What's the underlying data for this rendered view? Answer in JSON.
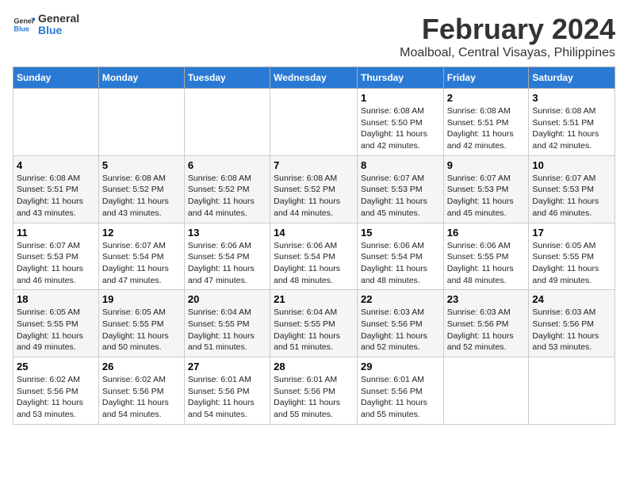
{
  "logo": {
    "line1": "General",
    "line2": "Blue"
  },
  "title": "February 2024",
  "subtitle": "Moalboal, Central Visayas, Philippines",
  "days_header": [
    "Sunday",
    "Monday",
    "Tuesday",
    "Wednesday",
    "Thursday",
    "Friday",
    "Saturday"
  ],
  "weeks": [
    [
      {
        "day": "",
        "info": ""
      },
      {
        "day": "",
        "info": ""
      },
      {
        "day": "",
        "info": ""
      },
      {
        "day": "",
        "info": ""
      },
      {
        "day": "1",
        "info": "Sunrise: 6:08 AM\nSunset: 5:50 PM\nDaylight: 11 hours\nand 42 minutes."
      },
      {
        "day": "2",
        "info": "Sunrise: 6:08 AM\nSunset: 5:51 PM\nDaylight: 11 hours\nand 42 minutes."
      },
      {
        "day": "3",
        "info": "Sunrise: 6:08 AM\nSunset: 5:51 PM\nDaylight: 11 hours\nand 42 minutes."
      }
    ],
    [
      {
        "day": "4",
        "info": "Sunrise: 6:08 AM\nSunset: 5:51 PM\nDaylight: 11 hours\nand 43 minutes."
      },
      {
        "day": "5",
        "info": "Sunrise: 6:08 AM\nSunset: 5:52 PM\nDaylight: 11 hours\nand 43 minutes."
      },
      {
        "day": "6",
        "info": "Sunrise: 6:08 AM\nSunset: 5:52 PM\nDaylight: 11 hours\nand 44 minutes."
      },
      {
        "day": "7",
        "info": "Sunrise: 6:08 AM\nSunset: 5:52 PM\nDaylight: 11 hours\nand 44 minutes."
      },
      {
        "day": "8",
        "info": "Sunrise: 6:07 AM\nSunset: 5:53 PM\nDaylight: 11 hours\nand 45 minutes."
      },
      {
        "day": "9",
        "info": "Sunrise: 6:07 AM\nSunset: 5:53 PM\nDaylight: 11 hours\nand 45 minutes."
      },
      {
        "day": "10",
        "info": "Sunrise: 6:07 AM\nSunset: 5:53 PM\nDaylight: 11 hours\nand 46 minutes."
      }
    ],
    [
      {
        "day": "11",
        "info": "Sunrise: 6:07 AM\nSunset: 5:53 PM\nDaylight: 11 hours\nand 46 minutes."
      },
      {
        "day": "12",
        "info": "Sunrise: 6:07 AM\nSunset: 5:54 PM\nDaylight: 11 hours\nand 47 minutes."
      },
      {
        "day": "13",
        "info": "Sunrise: 6:06 AM\nSunset: 5:54 PM\nDaylight: 11 hours\nand 47 minutes."
      },
      {
        "day": "14",
        "info": "Sunrise: 6:06 AM\nSunset: 5:54 PM\nDaylight: 11 hours\nand 48 minutes."
      },
      {
        "day": "15",
        "info": "Sunrise: 6:06 AM\nSunset: 5:54 PM\nDaylight: 11 hours\nand 48 minutes."
      },
      {
        "day": "16",
        "info": "Sunrise: 6:06 AM\nSunset: 5:55 PM\nDaylight: 11 hours\nand 48 minutes."
      },
      {
        "day": "17",
        "info": "Sunrise: 6:05 AM\nSunset: 5:55 PM\nDaylight: 11 hours\nand 49 minutes."
      }
    ],
    [
      {
        "day": "18",
        "info": "Sunrise: 6:05 AM\nSunset: 5:55 PM\nDaylight: 11 hours\nand 49 minutes."
      },
      {
        "day": "19",
        "info": "Sunrise: 6:05 AM\nSunset: 5:55 PM\nDaylight: 11 hours\nand 50 minutes."
      },
      {
        "day": "20",
        "info": "Sunrise: 6:04 AM\nSunset: 5:55 PM\nDaylight: 11 hours\nand 51 minutes."
      },
      {
        "day": "21",
        "info": "Sunrise: 6:04 AM\nSunset: 5:55 PM\nDaylight: 11 hours\nand 51 minutes."
      },
      {
        "day": "22",
        "info": "Sunrise: 6:03 AM\nSunset: 5:56 PM\nDaylight: 11 hours\nand 52 minutes."
      },
      {
        "day": "23",
        "info": "Sunrise: 6:03 AM\nSunset: 5:56 PM\nDaylight: 11 hours\nand 52 minutes."
      },
      {
        "day": "24",
        "info": "Sunrise: 6:03 AM\nSunset: 5:56 PM\nDaylight: 11 hours\nand 53 minutes."
      }
    ],
    [
      {
        "day": "25",
        "info": "Sunrise: 6:02 AM\nSunset: 5:56 PM\nDaylight: 11 hours\nand 53 minutes."
      },
      {
        "day": "26",
        "info": "Sunrise: 6:02 AM\nSunset: 5:56 PM\nDaylight: 11 hours\nand 54 minutes."
      },
      {
        "day": "27",
        "info": "Sunrise: 6:01 AM\nSunset: 5:56 PM\nDaylight: 11 hours\nand 54 minutes."
      },
      {
        "day": "28",
        "info": "Sunrise: 6:01 AM\nSunset: 5:56 PM\nDaylight: 11 hours\nand 55 minutes."
      },
      {
        "day": "29",
        "info": "Sunrise: 6:01 AM\nSunset: 5:56 PM\nDaylight: 11 hours\nand 55 minutes."
      },
      {
        "day": "",
        "info": ""
      },
      {
        "day": "",
        "info": ""
      }
    ]
  ]
}
